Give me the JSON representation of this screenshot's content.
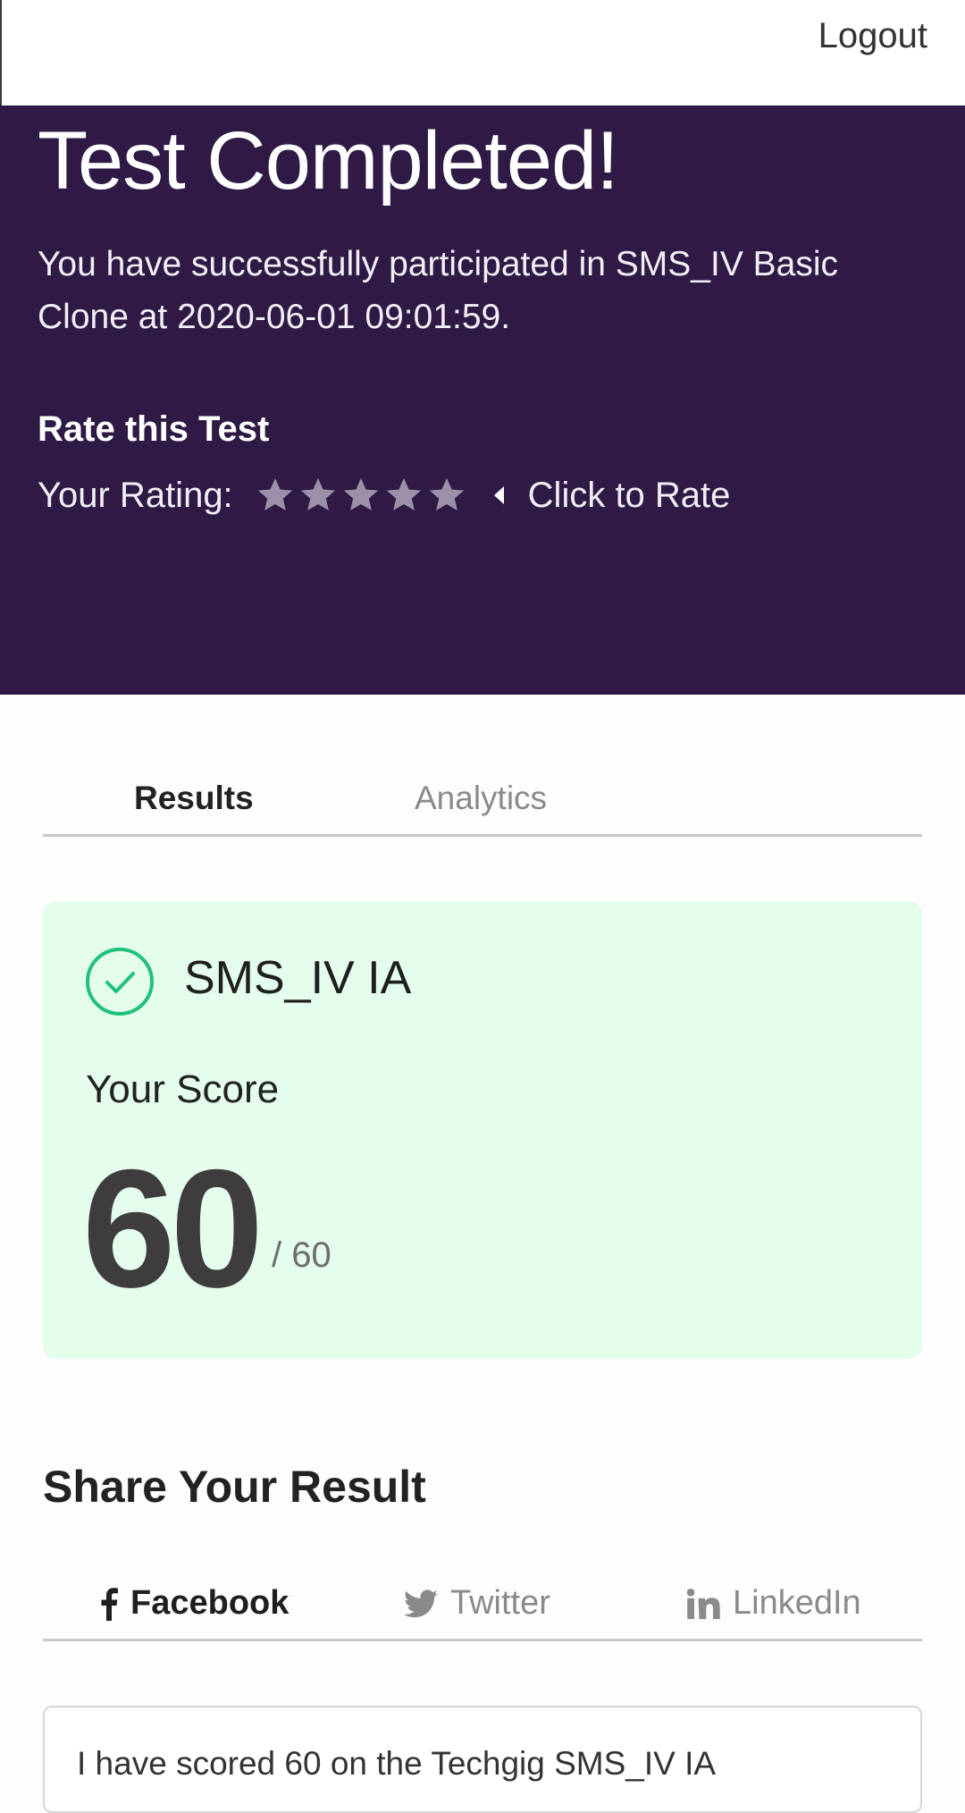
{
  "header": {
    "logout_label": "Logout"
  },
  "hero": {
    "title": "Test Completed!",
    "description": "You have successfully participated in SMS_IV Basic Clone at 2020-06-01 09:01:59.",
    "rate_title": "Rate this Test",
    "rating_label": "Your Rating:",
    "rating_value": 0,
    "rating_max": 5,
    "click_to_rate": "Click to Rate"
  },
  "tabs": {
    "results": "Results",
    "analytics": "Analytics",
    "active": "results"
  },
  "score_card": {
    "title": "SMS_IV IA",
    "score_label": "Your Score",
    "score": "60",
    "total": "/ 60"
  },
  "share": {
    "title": "Share Your Result",
    "facebook": "Facebook",
    "twitter": "Twitter",
    "linkedin": "LinkedIn",
    "active": "facebook",
    "message": "I have scored 60 on the Techgig SMS_IV IA"
  },
  "colors": {
    "hero_bg": "#2e1a45",
    "card_bg": "#e5fded",
    "check_green": "#22c17a",
    "star_inactive": "#9b90a8"
  },
  "icons": {
    "rating_star": "star-icon",
    "caret": "caret-left-icon",
    "check": "check-circle-icon",
    "facebook": "facebook-icon",
    "twitter": "twitter-icon",
    "linkedin": "linkedin-icon"
  }
}
